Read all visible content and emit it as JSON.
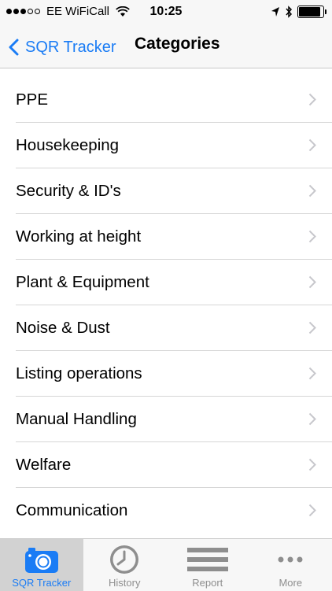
{
  "status_bar": {
    "carrier": "EE WiFiCall",
    "time": "10:25",
    "signal_bars_filled": 3,
    "signal_bars_total": 5,
    "battery_level": 0.9
  },
  "nav": {
    "back_label": "SQR Tracker",
    "title": "Categories",
    "accent_color": "#1a7cf5"
  },
  "categories": [
    {
      "label": "PPE"
    },
    {
      "label": "Housekeeping"
    },
    {
      "label": "Security & ID's"
    },
    {
      "label": "Working at height"
    },
    {
      "label": "Plant & Equipment"
    },
    {
      "label": "Noise & Dust"
    },
    {
      "label": "Listing operations"
    },
    {
      "label": "Manual Handling"
    },
    {
      "label": "Welfare"
    },
    {
      "label": "Communication"
    }
  ],
  "tab_bar": {
    "tabs": [
      {
        "label": "SQR Tracker",
        "icon": "camera-icon",
        "active": true
      },
      {
        "label": "History",
        "icon": "clock-icon",
        "active": false
      },
      {
        "label": "Report",
        "icon": "report-icon",
        "active": false
      },
      {
        "label": "More",
        "icon": "more-icon",
        "active": false
      }
    ]
  }
}
